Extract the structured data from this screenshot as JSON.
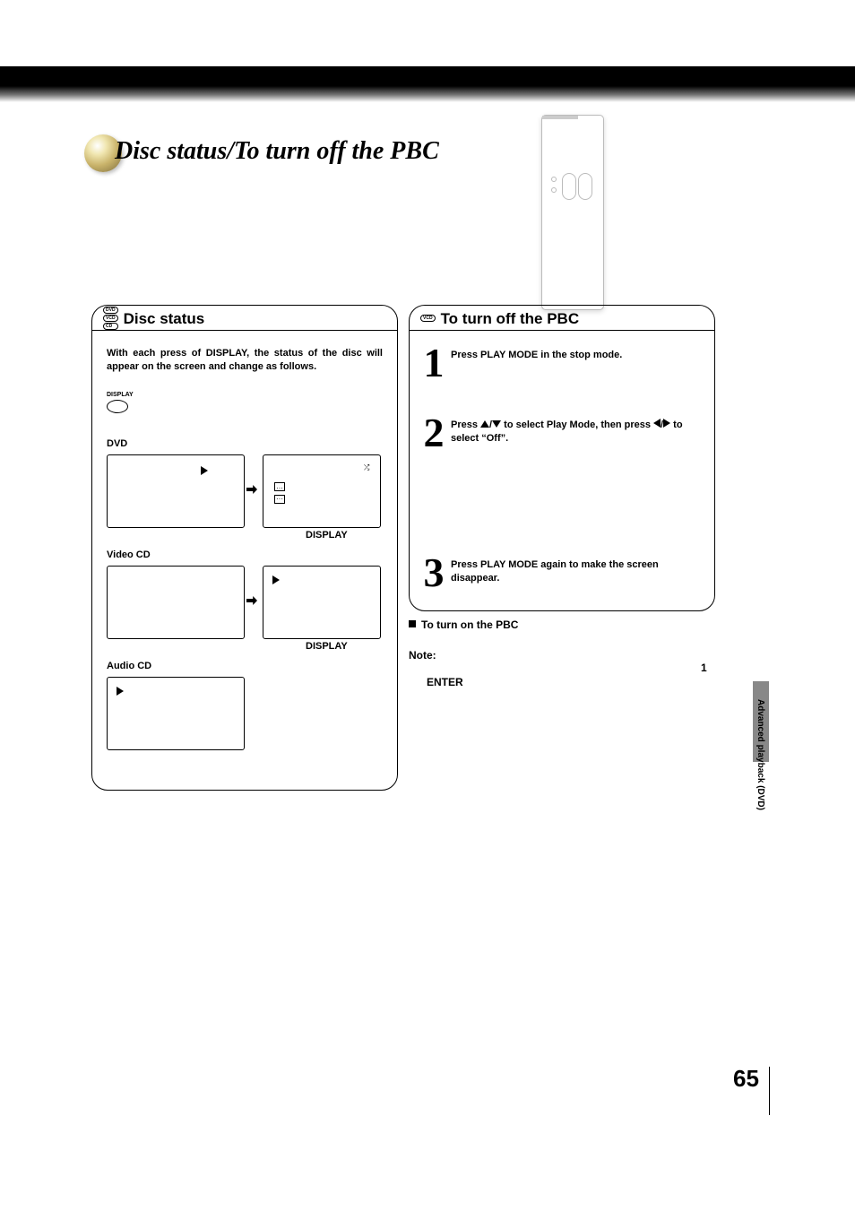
{
  "header": {
    "title": "Disc status/To turn off the PBC"
  },
  "left": {
    "title": "Disc status",
    "lozenges": [
      "DVD",
      "VCD",
      "CD"
    ],
    "intro": "With each press of DISPLAY, the status of the disc will appear on the screen and change as follows.",
    "display_btn": "DISPLAY",
    "display_caption": "DISPLAY",
    "groups": [
      {
        "label": "DVD"
      },
      {
        "label": "Video CD"
      },
      {
        "label": "Audio CD"
      }
    ]
  },
  "right": {
    "title": "To turn off the PBC",
    "lozenge": "VCD",
    "steps": [
      {
        "num": "1",
        "text": "Press PLAY MODE in the stop mode."
      },
      {
        "num": "2",
        "pre": "Press ",
        "mid": " to select Play Mode, then press ",
        "post": " to select “Off”."
      },
      {
        "num": "3",
        "text": "Press PLAY MODE again to make the screen disappear."
      }
    ],
    "turn_on_heading": "To turn on the PBC",
    "note_label": "Note:",
    "note_tail": "1",
    "note_enter": "ENTER"
  },
  "footer": {
    "side_tab": "Advanced playback (DVD)",
    "page": "65"
  }
}
